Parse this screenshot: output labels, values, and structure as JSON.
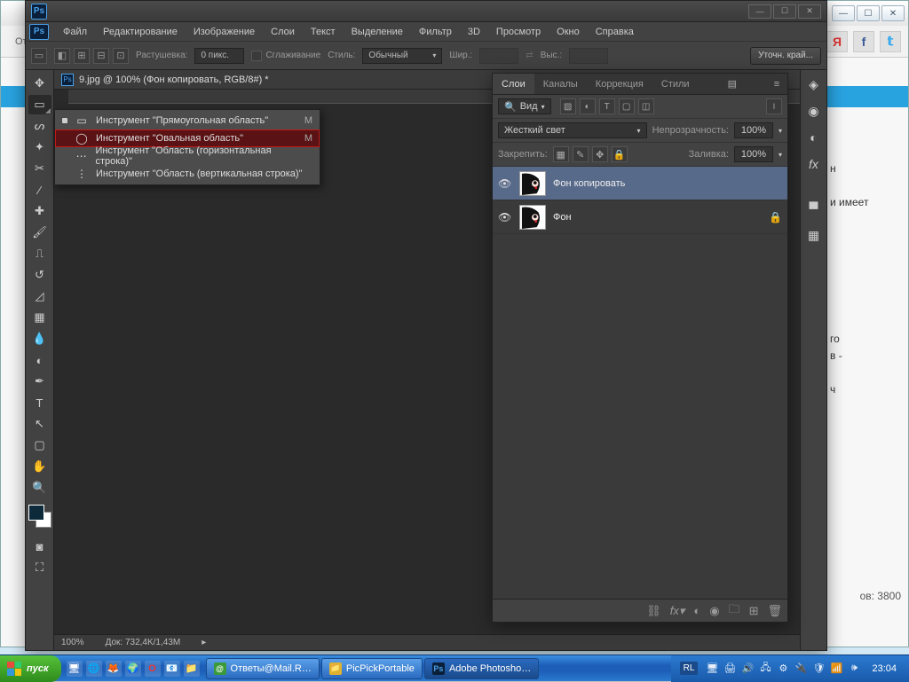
{
  "bg": {
    "tabtext": "От",
    "side_lines": [
      "н",
      "и имеет",
      "го",
      "в -",
      "ч"
    ],
    "views": "ов: 3800"
  },
  "ps": {
    "menu": [
      "Файл",
      "Редактирование",
      "Изображение",
      "Слои",
      "Текст",
      "Выделение",
      "Фильтр",
      "3D",
      "Просмотр",
      "Окно",
      "Справка"
    ],
    "options": {
      "feather_label": "Растушевка:",
      "feather_value": "0 пикс.",
      "antialias": "Сглаживание",
      "style_label": "Стиль:",
      "style_value": "Обычный",
      "width_label": "Шир.:",
      "height_label": "Выс.:",
      "refine": "Уточн. край..."
    },
    "doc_title": "9.jpg @ 100% (Фон копировать, RGB/8#) *",
    "status_zoom": "100%",
    "status_doc": "Док: 732,4K/1,43M",
    "flyout": [
      {
        "icon": "▭",
        "label": "Инструмент \"Прямоугольная область\"",
        "key": "M",
        "current": true
      },
      {
        "icon": "◯",
        "label": "Инструмент \"Овальная область\"",
        "key": "M",
        "selected": true
      },
      {
        "icon": "⋯",
        "label": "Инструмент \"Область (горизонтальная строка)\"",
        "key": ""
      },
      {
        "icon": "⋮",
        "label": "Инструмент \"Область (вертикальная строка)\"",
        "key": ""
      }
    ]
  },
  "layers": {
    "tabs": [
      "Слои",
      "Каналы",
      "Коррекция",
      "Стили"
    ],
    "kind_label": "Вид",
    "blend_mode": "Жесткий свет",
    "opacity_label": "Непрозрачность:",
    "opacity_value": "100%",
    "lock_label": "Закрепить:",
    "fill_label": "Заливка:",
    "fill_value": "100%",
    "items": [
      {
        "name": "Фон копировать",
        "selected": true,
        "locked": false
      },
      {
        "name": "Фон",
        "selected": false,
        "locked": true
      }
    ]
  },
  "taskbar": {
    "start": "пуск",
    "tasks": [
      {
        "label": "Ответы@Mail.R…",
        "color": "#3a9a3a",
        "letter": "A"
      },
      {
        "label": "PicPickPortable",
        "color": "#e0b030",
        "letter": "📁"
      },
      {
        "label": "Adobe Photosho…",
        "color": "#0a1f3a",
        "letter": "Ps",
        "active": true
      }
    ],
    "lang": "RL",
    "time": "23:04"
  }
}
